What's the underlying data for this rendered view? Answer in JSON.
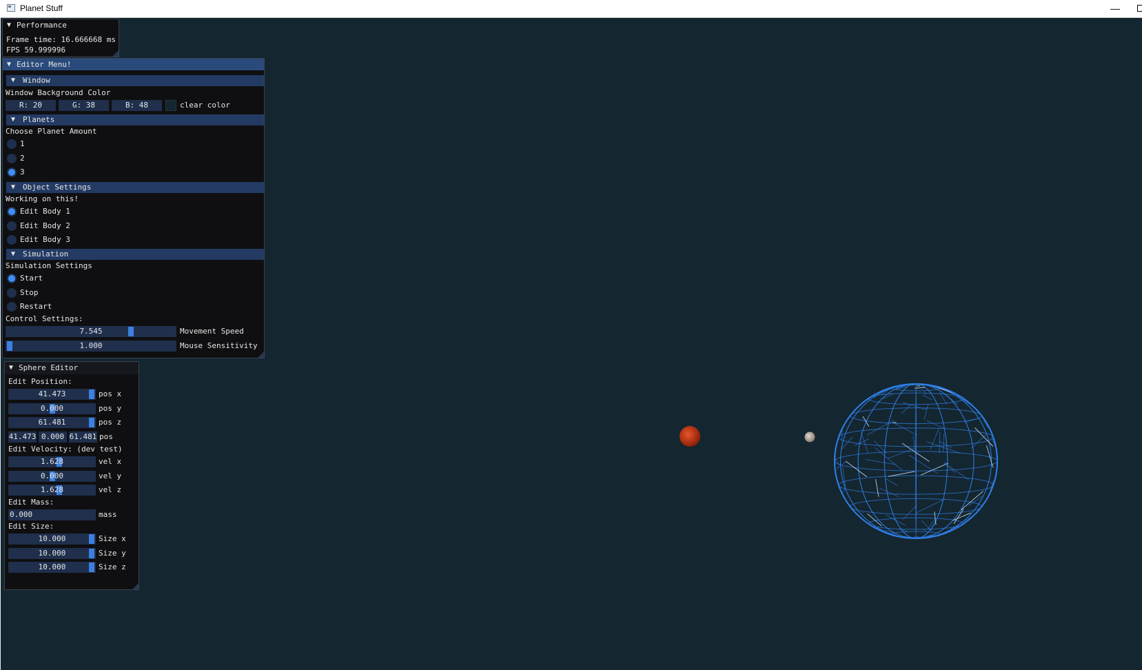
{
  "window": {
    "title": "Planet Stuff",
    "minimize": "—"
  },
  "performance": {
    "title": "Performance",
    "frame_time": "Frame time: 16.666668 ms",
    "fps": "FPS 59.999996"
  },
  "editor": {
    "title": "Editor Menu!",
    "window_section": {
      "title": "Window",
      "label": "Window Background Color",
      "r": "R: 20",
      "g": "G: 38",
      "b": "B: 48",
      "clear_color_label": "clear color",
      "clear_color": "#142630"
    },
    "planets_section": {
      "title": "Planets",
      "label": "Choose Planet Amount",
      "options": [
        "1",
        "2",
        "3"
      ],
      "selected": "3"
    },
    "object_section": {
      "title": "Object Settings",
      "label": "Working on this!",
      "options": [
        "Edit Body 1",
        "Edit Body 2",
        "Edit Body 3"
      ],
      "selected": "Edit Body 1"
    },
    "simulation_section": {
      "title": "Simulation",
      "label": "Simulation Settings",
      "options": [
        "Start",
        "Stop",
        "Restart"
      ],
      "selected": "Start",
      "controls_label": "Control Settings:",
      "movement_speed": {
        "value": "7.545",
        "label": "Movement Speed"
      },
      "mouse_sensitivity": {
        "value": "1.000",
        "label": "Mouse Sensitivity"
      }
    }
  },
  "sphere_editor": {
    "title": "Sphere Editor",
    "position_label": "Edit Position:",
    "pos_x": {
      "value": "41.473",
      "label": "pos x"
    },
    "pos_y": {
      "value": "0.000",
      "label": "pos y"
    },
    "pos_z": {
      "value": "61.481",
      "label": "pos z"
    },
    "pos_vec": {
      "x": "41.473",
      "y": "0.000",
      "z": "61.481",
      "label": "pos"
    },
    "velocity_label": "Edit Velocity: (dev test)",
    "vel_x": {
      "value": "1.628",
      "label": "vel x"
    },
    "vel_y": {
      "value": "0.000",
      "label": "vel y"
    },
    "vel_z": {
      "value": "1.628",
      "label": "vel z"
    },
    "mass_label": "Edit Mass:",
    "mass": {
      "value": "0.000",
      "label": "mass"
    },
    "size_label": "Edit Size:",
    "size_x": {
      "value": "10.000",
      "label": "Size x"
    },
    "size_y": {
      "value": "10.000",
      "label": "Size y"
    },
    "size_z": {
      "value": "10.000",
      "label": "Size z"
    }
  },
  "scene_colors": {
    "background": "#142630",
    "red_planet": "#c83a16",
    "grey_planet": "#b8aa9c",
    "wireframe": "#2f7fe8"
  }
}
